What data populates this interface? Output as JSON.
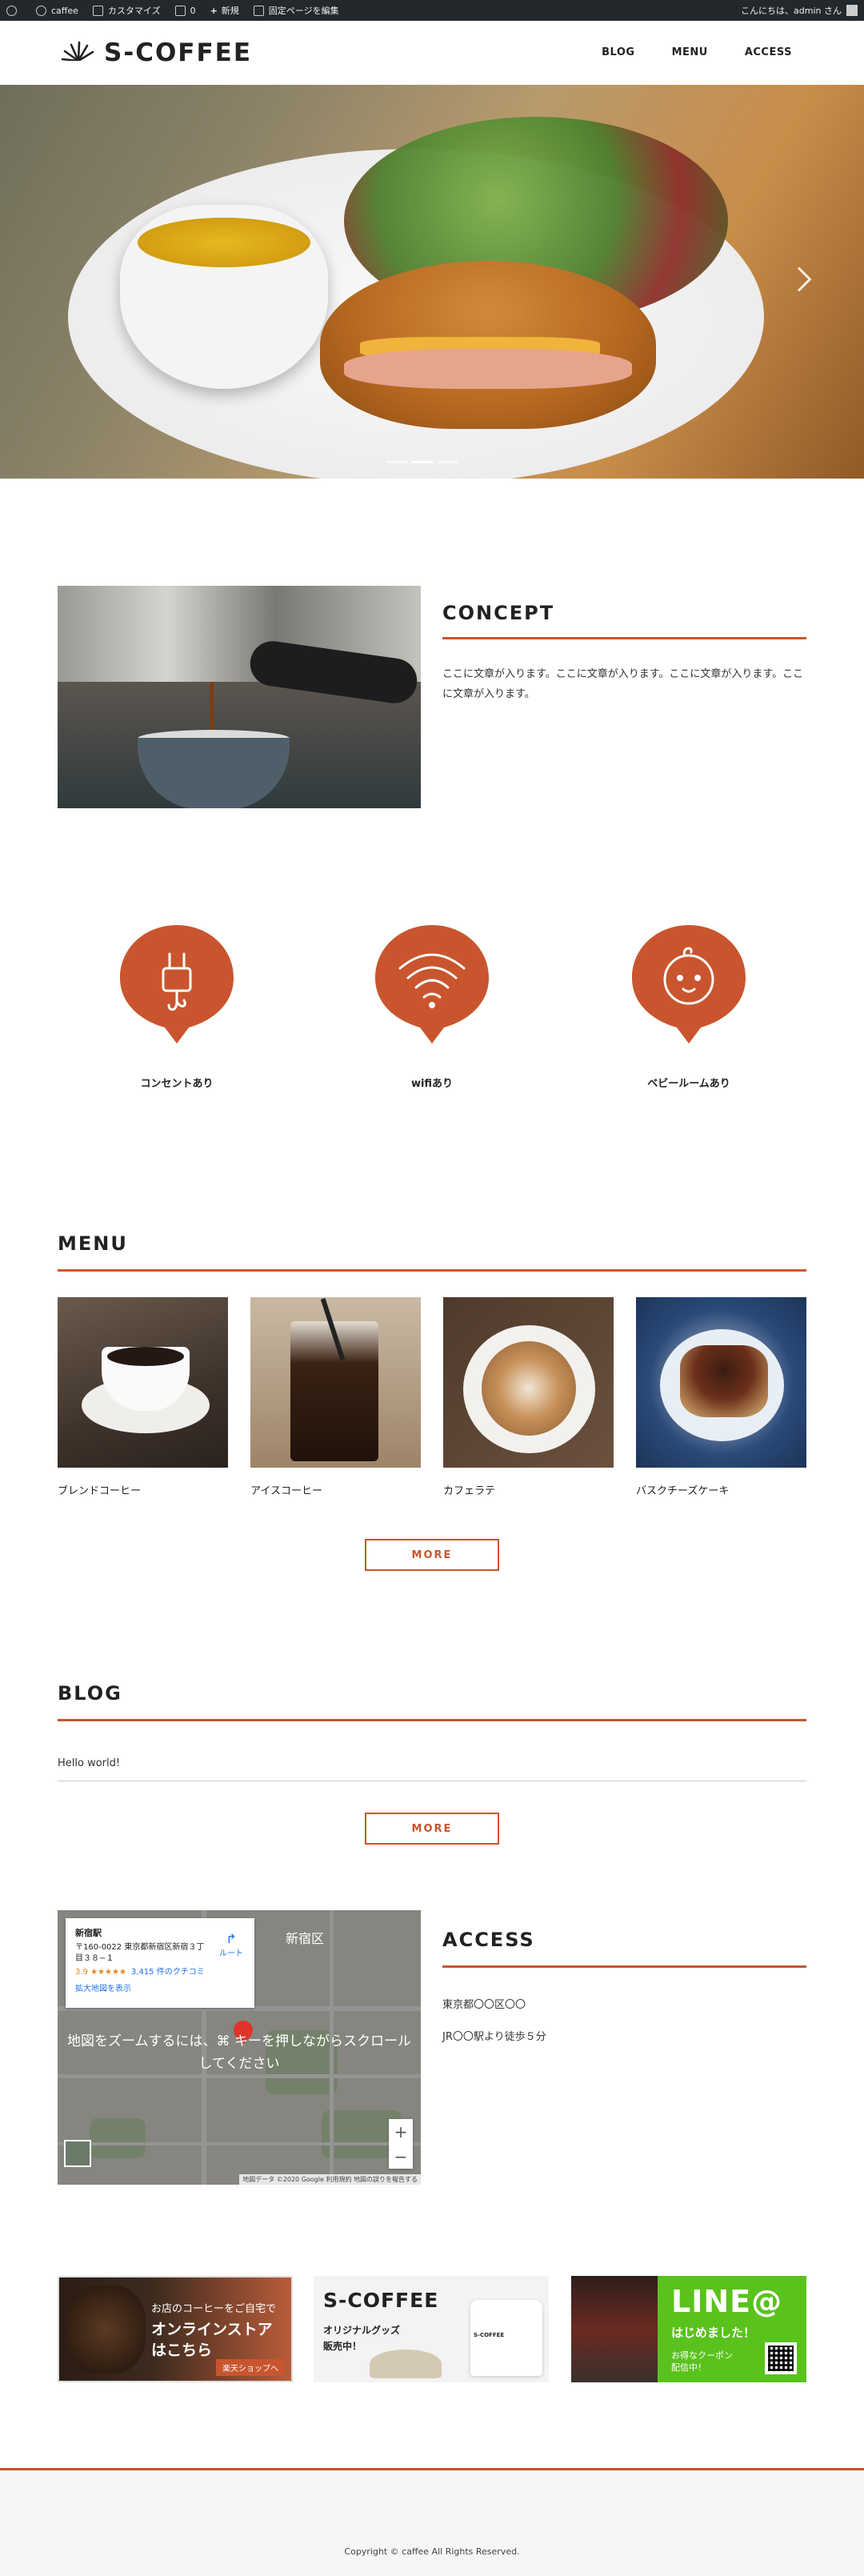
{
  "admin_bar": {
    "items": [
      "caffee",
      "カスタマイズ",
      "0",
      "新規",
      "固定ページを編集"
    ],
    "greeting": "こんにちは、admin さん"
  },
  "header": {
    "logo_text": "S-COFFEE",
    "nav": [
      "BLOG",
      "MENU",
      "ACCESS"
    ]
  },
  "hero": {
    "slide_count": 3,
    "active_slide": 2
  },
  "concept": {
    "title": "CONCEPT",
    "text": "ここに文章が入ります。ここに文章が入ります。ここに文章が入ります。ここに文章が入ります。"
  },
  "features": [
    {
      "label": "コンセントあり",
      "icon": "plug-icon"
    },
    {
      "label": "wifiあり",
      "icon": "wifi-icon"
    },
    {
      "label": "ベビールームあり",
      "icon": "baby-icon"
    }
  ],
  "menu": {
    "title": "MENU",
    "items": [
      {
        "label": "ブレンドコーヒー"
      },
      {
        "label": "アイスコーヒー"
      },
      {
        "label": "カフェラテ"
      },
      {
        "label": "バスクチーズケーキ"
      }
    ],
    "more_label": "MORE"
  },
  "blog": {
    "title": "BLOG",
    "posts": [
      "Hello world!"
    ],
    "more_label": "MORE"
  },
  "access": {
    "title": "ACCESS",
    "address": "東京都〇〇区〇〇",
    "directions": "JR〇〇駅より徒歩５分",
    "map": {
      "place": "新宿駅",
      "address": "〒160-0022 東京都新宿区新宿３丁目３８−１",
      "rating": "3.9 ★★★★★",
      "reviews": "3,415 件のクチコミ",
      "route_label": "ルート",
      "enlarge_label": "拡大地図を表示",
      "district": "新宿区",
      "zoom_message": "地図をズームするには、⌘ キーを押しながらスクロールしてください",
      "zoom_in": "+",
      "zoom_out": "−",
      "attribution": "地図データ ©2020 Google   利用規約   地図の誤りを報告する"
    }
  },
  "banners": {
    "shop": {
      "line1": "お店のコーヒーをご自宅で",
      "line2": "オンラインストア",
      "line3": "はこちら",
      "button": "楽天ショップへ"
    },
    "goods": {
      "brand": "S-COFFEE",
      "line1": "オリジナルグッズ",
      "line2": "販売中！",
      "tee_text": "S-COFFEE"
    },
    "line": {
      "title": "LINE@",
      "line1": "はじめました！",
      "line2": "お得なクーポン",
      "line3": "配信中！"
    }
  },
  "footer": {
    "copyright": "Copyright © caffee All Rights Reserved."
  },
  "colors": {
    "accent": "#c9552e",
    "admin_bar": "#23282d",
    "line_green": "#5ac21d"
  }
}
